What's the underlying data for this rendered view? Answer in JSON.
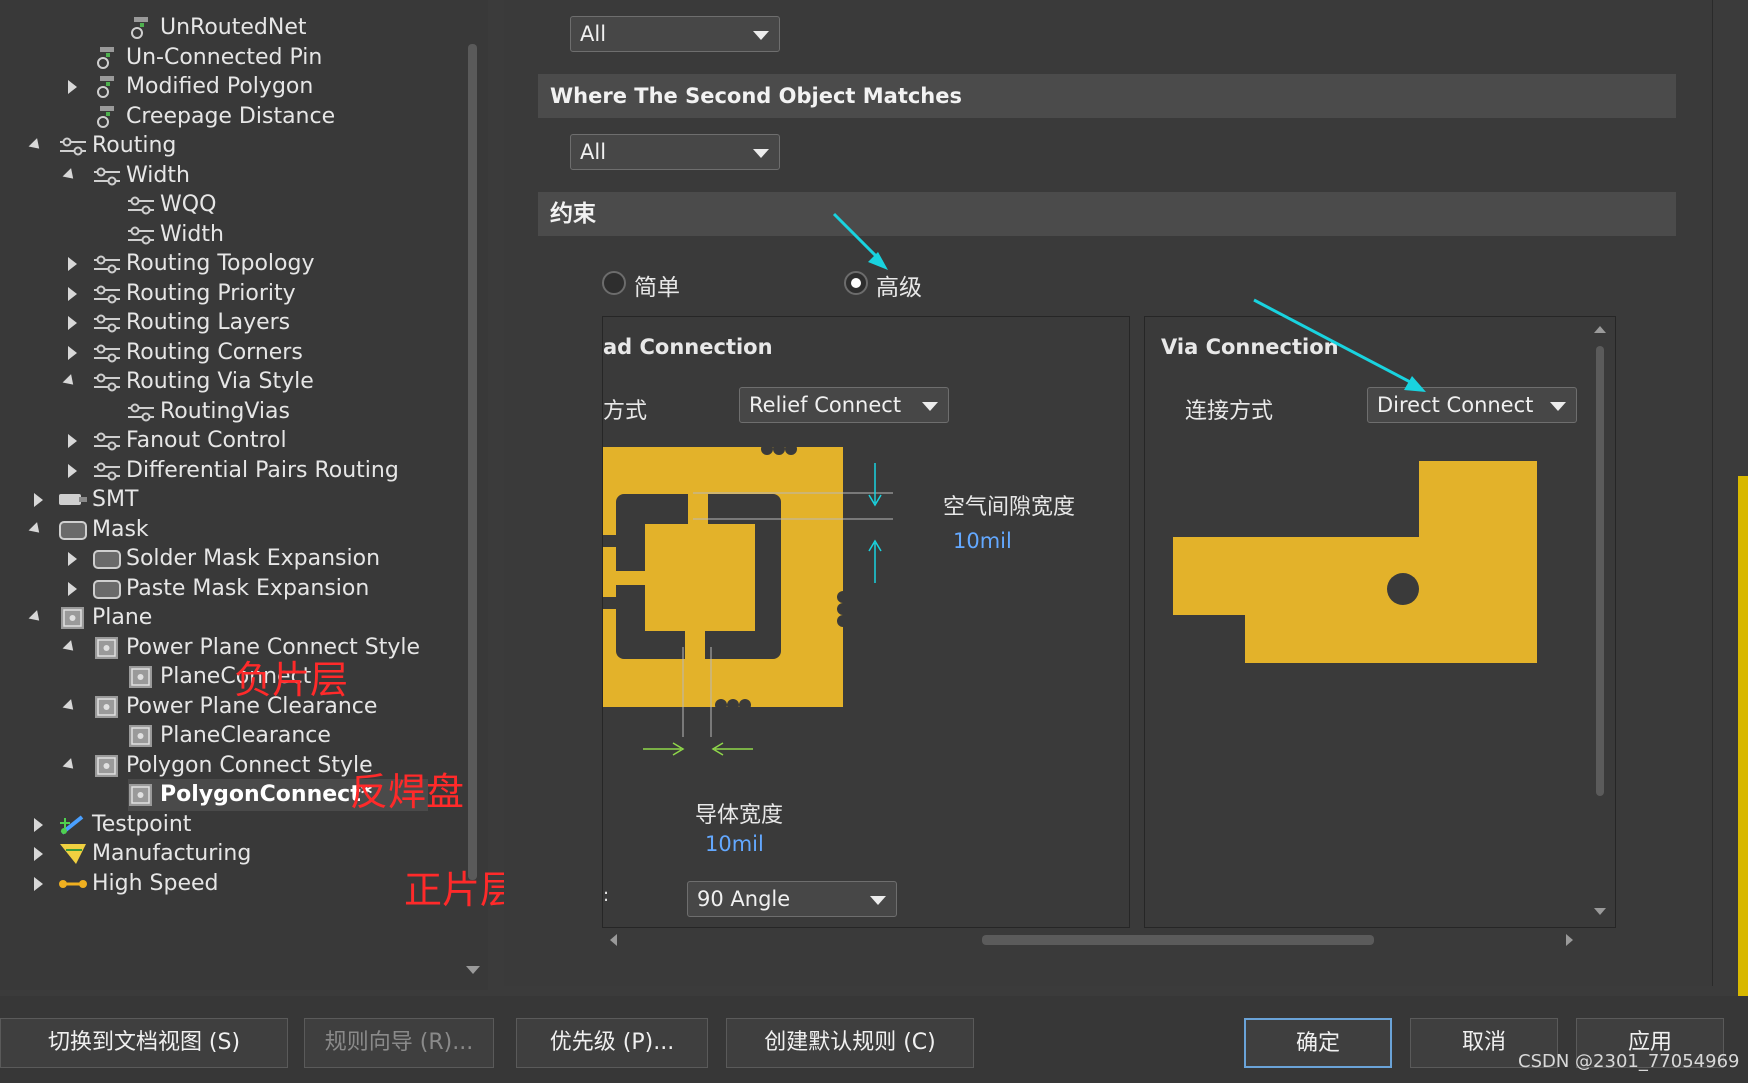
{
  "tree": {
    "rows": [
      {
        "label": "UnRoutedNet",
        "indent": 3,
        "toggle": "none",
        "icon": "unrouted-icon"
      },
      {
        "label": "Un-Connected Pin",
        "indent": 2,
        "toggle": "none",
        "icon": "unrouted-icon"
      },
      {
        "label": "Modified Polygon",
        "indent": 2,
        "toggle": "collapsed",
        "icon": "unrouted-icon"
      },
      {
        "label": "Creepage Distance",
        "indent": 2,
        "toggle": "none",
        "icon": "unrouted-icon"
      },
      {
        "label": "Routing",
        "indent": 1,
        "toggle": "expanded",
        "icon": "routing-icon"
      },
      {
        "label": "Width",
        "indent": 2,
        "toggle": "expanded",
        "icon": "routing-icon"
      },
      {
        "label": "WQQ",
        "indent": 3,
        "toggle": "none",
        "icon": "routing-icon"
      },
      {
        "label": "Width",
        "indent": 3,
        "toggle": "none",
        "icon": "routing-icon"
      },
      {
        "label": "Routing Topology",
        "indent": 2,
        "toggle": "collapsed",
        "icon": "routing-icon"
      },
      {
        "label": "Routing Priority",
        "indent": 2,
        "toggle": "collapsed",
        "icon": "routing-icon"
      },
      {
        "label": "Routing Layers",
        "indent": 2,
        "toggle": "collapsed",
        "icon": "routing-icon"
      },
      {
        "label": "Routing Corners",
        "indent": 2,
        "toggle": "collapsed",
        "icon": "routing-icon"
      },
      {
        "label": "Routing Via Style",
        "indent": 2,
        "toggle": "expanded",
        "icon": "routing-icon"
      },
      {
        "label": "RoutingVias",
        "indent": 3,
        "toggle": "none",
        "icon": "routing-icon"
      },
      {
        "label": "Fanout Control",
        "indent": 2,
        "toggle": "collapsed",
        "icon": "routing-icon"
      },
      {
        "label": "Differential Pairs Routing",
        "indent": 2,
        "toggle": "collapsed",
        "icon": "routing-icon"
      },
      {
        "label": "SMT",
        "indent": 1,
        "toggle": "collapsed",
        "icon": "smt-icon"
      },
      {
        "label": "Mask",
        "indent": 1,
        "toggle": "expanded",
        "icon": "mask-icon"
      },
      {
        "label": "Solder Mask Expansion",
        "indent": 2,
        "toggle": "collapsed",
        "icon": "mask-icon"
      },
      {
        "label": "Paste Mask Expansion",
        "indent": 2,
        "toggle": "collapsed",
        "icon": "mask-icon"
      },
      {
        "label": "Plane",
        "indent": 1,
        "toggle": "expanded",
        "icon": "plane-icon"
      },
      {
        "label": "Power Plane Connect Style",
        "indent": 2,
        "toggle": "expanded",
        "icon": "plane-icon"
      },
      {
        "label": "PlaneConnect",
        "indent": 3,
        "toggle": "none",
        "icon": "plane-icon"
      },
      {
        "label": "Power Plane Clearance",
        "indent": 2,
        "toggle": "expanded",
        "icon": "plane-icon"
      },
      {
        "label": "PlaneClearance",
        "indent": 3,
        "toggle": "none",
        "icon": "plane-icon"
      },
      {
        "label": "Polygon Connect Style",
        "indent": 2,
        "toggle": "expanded",
        "icon": "plane-icon"
      },
      {
        "label": "PolygonConnect*",
        "indent": 3,
        "toggle": "none",
        "icon": "plane-icon",
        "selected": true
      },
      {
        "label": "Testpoint",
        "indent": 1,
        "toggle": "collapsed",
        "icon": "testpoint-icon"
      },
      {
        "label": "Manufacturing",
        "indent": 1,
        "toggle": "collapsed",
        "icon": "manufacturing-icon"
      },
      {
        "label": "High Speed",
        "indent": 1,
        "toggle": "collapsed",
        "icon": "highspeed-icon"
      }
    ],
    "annotations": {
      "negative_layer": "负片层",
      "anti_pad": "反焊盘",
      "positive_layer": "正片层"
    }
  },
  "right": {
    "first_match_value": "All",
    "second_header": "Where The Second Object Matches",
    "second_match_value": "All",
    "constraints_header": "约束",
    "radio_simple": "简单",
    "radio_advanced": "高级",
    "pad_connection_title": "ad Connection",
    "pad_method_label": "方式",
    "pad_method_value": "Relief Connect",
    "air_gap_label": "空气间隙宽度",
    "air_gap_value": "10mil",
    "conductor_label": "导体宽度",
    "conductor_value": "10mil",
    "rotation_prefix": ":",
    "rotation_value": "90 Angle",
    "via_connection_title": "Via Connection",
    "via_method_label": "连接方式",
    "via_method_value": "Direct Connect"
  },
  "buttons": {
    "switch_doc_view": "切换到文档视图 (S)",
    "rule_wizard": "规则向导 (R)...",
    "priority": "优先级 (P)...",
    "create_default_rules": "创建默认规则 (C)",
    "ok": "确定",
    "cancel": "取消",
    "apply": "应用"
  },
  "watermark": "CSDN @2301_77054969",
  "colors": {
    "copper": "#e3b22a",
    "arrow": "#19d3df",
    "annotation": "#ff2a2a",
    "link_blue": "#63a8ff"
  }
}
